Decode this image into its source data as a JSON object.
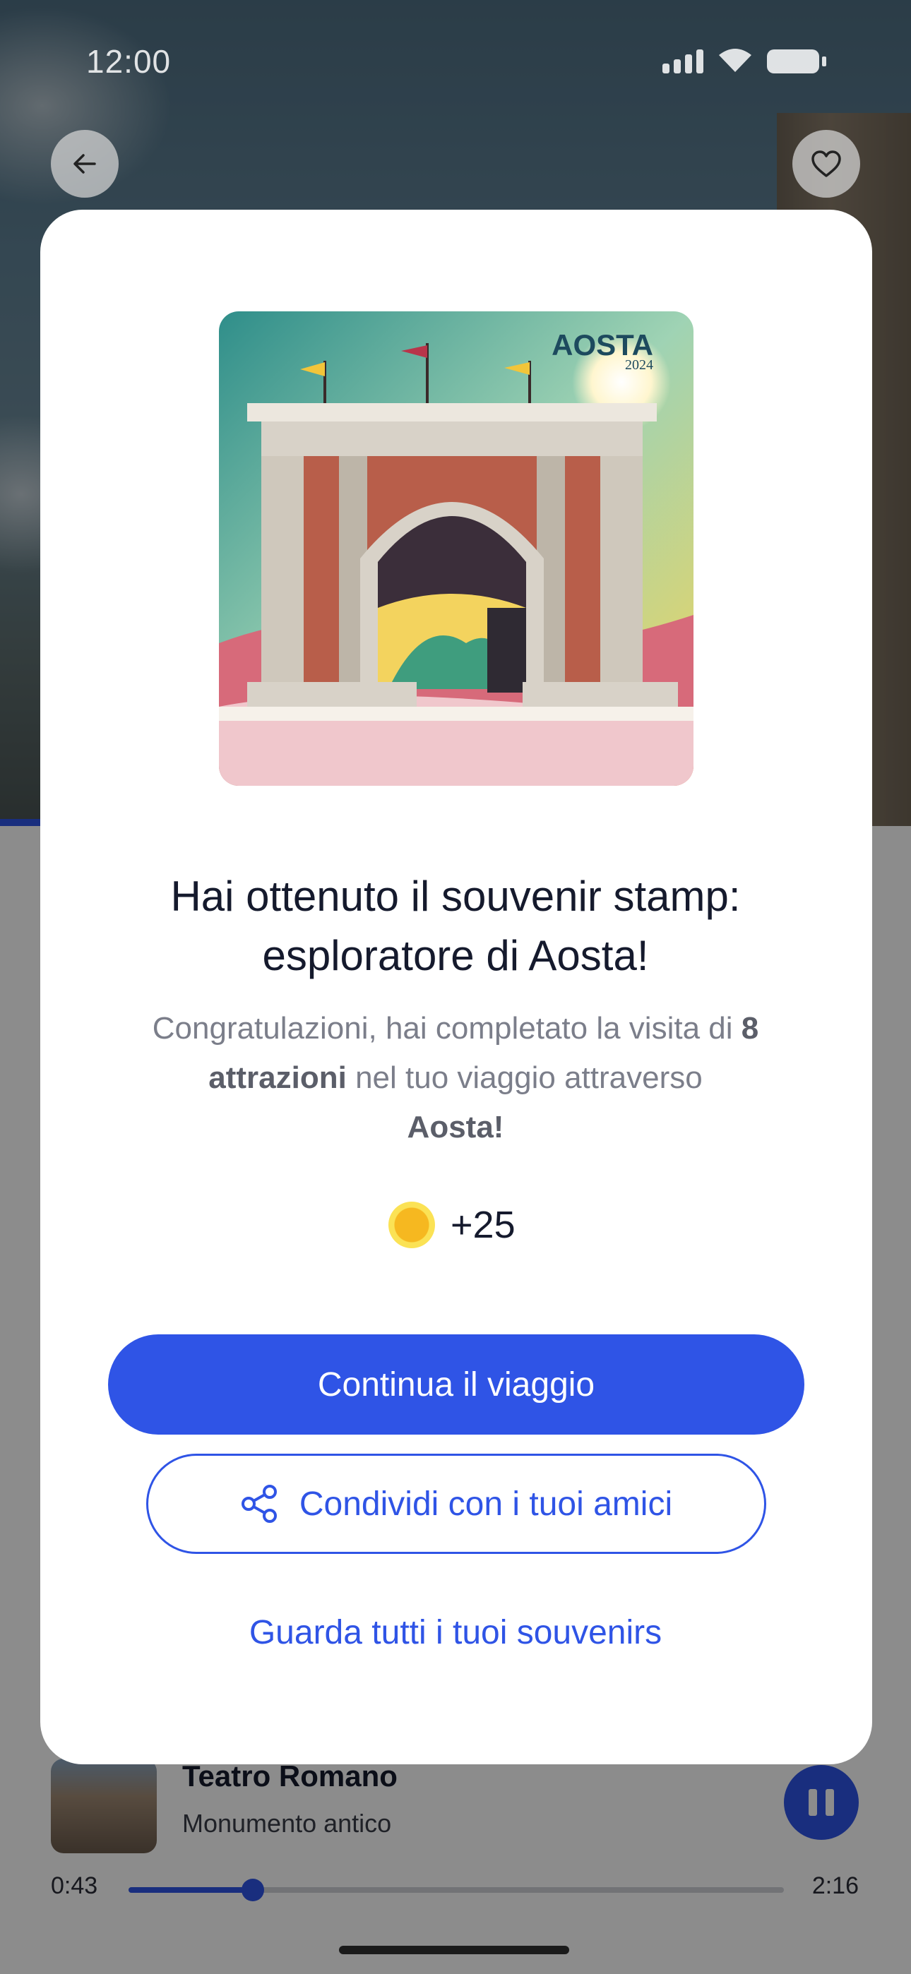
{
  "status_bar": {
    "time": "12:00"
  },
  "header": {
    "back_icon": "arrow-left-icon",
    "favorite_icon": "heart-icon"
  },
  "stamp": {
    "title": "AOSTA",
    "year": "2024",
    "image": "arch-of-augustus-illustration"
  },
  "modal": {
    "headline_line1": "Hai ottenuto il souvenir stamp:",
    "headline_line2": "esploratore di Aosta!",
    "desc_prefix": "Congratulazioni, hai completato la visita di",
    "desc_bold1": "8 attrazioni",
    "desc_mid": "nel tuo viaggio attraverso",
    "desc_bold2": "Aosta!",
    "reward_icon": "coin-icon",
    "reward": "+25",
    "primary_button": "Continua il viaggio",
    "share_icon": "share-icon",
    "secondary_button": "Condividi con i tuoi amici",
    "link": "Guarda tutti i tuoi souvenirs"
  },
  "player": {
    "title": "Teatro Romano",
    "subtitle": "Monumento antico",
    "elapsed": "0:43",
    "duration": "2:16",
    "progress": 0.19,
    "pause_icon": "pause-icon"
  },
  "colors": {
    "accent": "#2f54e6",
    "text": "#151a2d",
    "muted": "#7b7e8a",
    "coin": "#f6b820"
  }
}
